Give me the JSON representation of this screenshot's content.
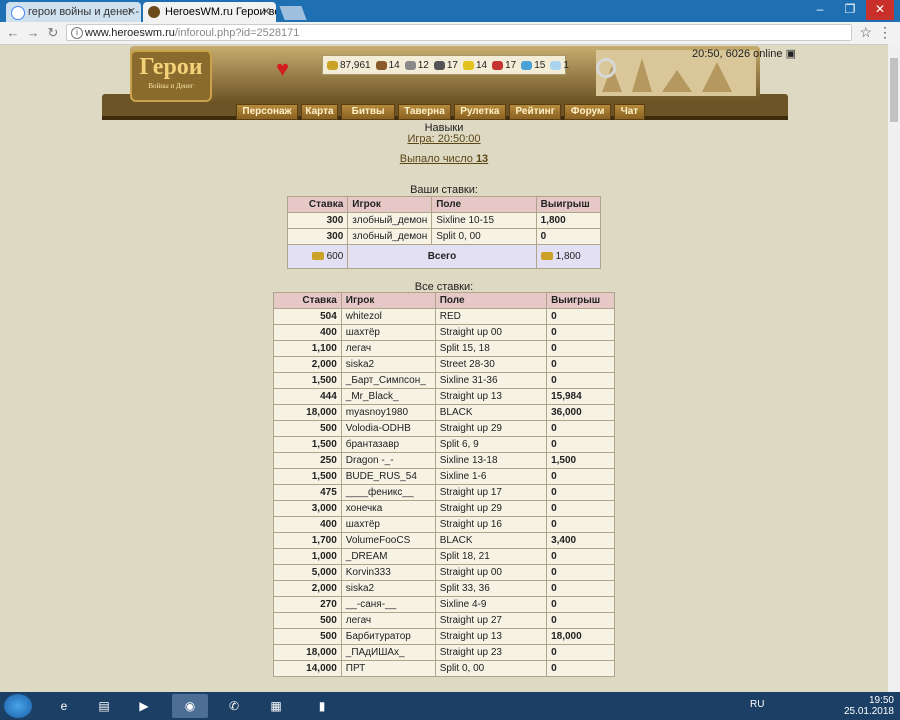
{
  "browser": {
    "tabs": [
      {
        "title": "герои войны и денег - "
      },
      {
        "title": "HeroesWM.ru Герои вой"
      }
    ],
    "url_host": "www.heroeswm.ru",
    "url_path": "/inforoul.php?id=2528171"
  },
  "header": {
    "online": "20:50, 6026 online",
    "logo_title": "Герои",
    "logo_sub": "Войны и Денег",
    "resources": [
      {
        "value": "87,961",
        "icon": "gold-icon",
        "color": "#c9a227"
      },
      {
        "value": "14",
        "icon": "wood-icon",
        "color": "#8b5a2b"
      },
      {
        "value": "12",
        "icon": "ore-icon",
        "color": "#8a8a8a"
      },
      {
        "value": "17",
        "icon": "mercury-icon",
        "color": "#555555"
      },
      {
        "value": "14",
        "icon": "sulfur-icon",
        "color": "#e2c21b"
      },
      {
        "value": "17",
        "icon": "crystal-icon",
        "color": "#c4332f"
      },
      {
        "value": "15",
        "icon": "gems-icon",
        "color": "#4aa3d8"
      },
      {
        "value": "1",
        "icon": "diamond-icon",
        "color": "#aad4ef"
      }
    ],
    "menu": [
      "Персонаж",
      "Карта",
      "Битвы",
      "Таверна",
      "Рулетка",
      "Рейтинг",
      "Форум",
      "Чат"
    ]
  },
  "page": {
    "skills_link": "Навыки",
    "game_link": "Игра: 20:50:00",
    "result_text": "Выпало число",
    "result_number": "13"
  },
  "my_bets": {
    "title": "Ваши ставки:",
    "headers": [
      "Ставка",
      "Игрок",
      "Поле",
      "Выигрыш"
    ],
    "rows": [
      [
        "300",
        "злобный_демон",
        "Sixline 10-15",
        "1,800"
      ],
      [
        "300",
        "злобный_демон",
        "Split 0, 00",
        "0"
      ]
    ],
    "total_stake": "600",
    "total_label": "Всего",
    "total_win": "1,800"
  },
  "all_bets": {
    "title": "Все ставки:",
    "headers": [
      "Ставка",
      "Игрок",
      "Поле",
      "Выигрыш"
    ],
    "rows": [
      [
        "504",
        "whitezol",
        "RED",
        "0"
      ],
      [
        "400",
        "шахтёр",
        "Straight up 00",
        "0"
      ],
      [
        "1,100",
        "легач",
        "Split 15, 18",
        "0"
      ],
      [
        "2,000",
        "siska2",
        "Street 28-30",
        "0"
      ],
      [
        "1,500",
        "_Барт_Симпсон_",
        "Sixline 31-36",
        "0"
      ],
      [
        "444",
        "_Mr_Black_",
        "Straight up 13",
        "15,984"
      ],
      [
        "18,000",
        "myasnoy1980",
        "BLACK",
        "36,000"
      ],
      [
        "500",
        "Volodia-ODHB",
        "Straight up 29",
        "0"
      ],
      [
        "1,500",
        "брантазавр",
        "Split 6, 9",
        "0"
      ],
      [
        "250",
        "Dragon -_-",
        "Sixline 13-18",
        "1,500"
      ],
      [
        "1,500",
        "BUDE_RUS_54",
        "Sixline 1-6",
        "0"
      ],
      [
        "475",
        "____феникс__",
        "Straight up 17",
        "0"
      ],
      [
        "3,000",
        "хонечка",
        "Straight up 29",
        "0"
      ],
      [
        "400",
        "шахтёр",
        "Straight up 16",
        "0"
      ],
      [
        "1,700",
        "VolumeFooCS",
        "BLACK",
        "3,400"
      ],
      [
        "1,000",
        "_DREAM",
        "Split 18, 21",
        "0"
      ],
      [
        "5,000",
        "Korvin333",
        "Straight up 00",
        "0"
      ],
      [
        "2,000",
        "siska2",
        "Split 33, 36",
        "0"
      ],
      [
        "270",
        "__-саня-__",
        "Sixline 4-9",
        "0"
      ],
      [
        "500",
        "легач",
        "Straight up 27",
        "0"
      ],
      [
        "500",
        "Барбитуратор",
        "Straight up 13",
        "18,000"
      ],
      [
        "18,000",
        "_ПАдИШАх_",
        "Straight up 23",
        "0"
      ],
      [
        "14,000",
        "ПРТ",
        "Split 0, 00",
        "0"
      ]
    ]
  },
  "taskbar": {
    "lang": "RU",
    "time": "19:50",
    "date": "25.01.2018"
  }
}
